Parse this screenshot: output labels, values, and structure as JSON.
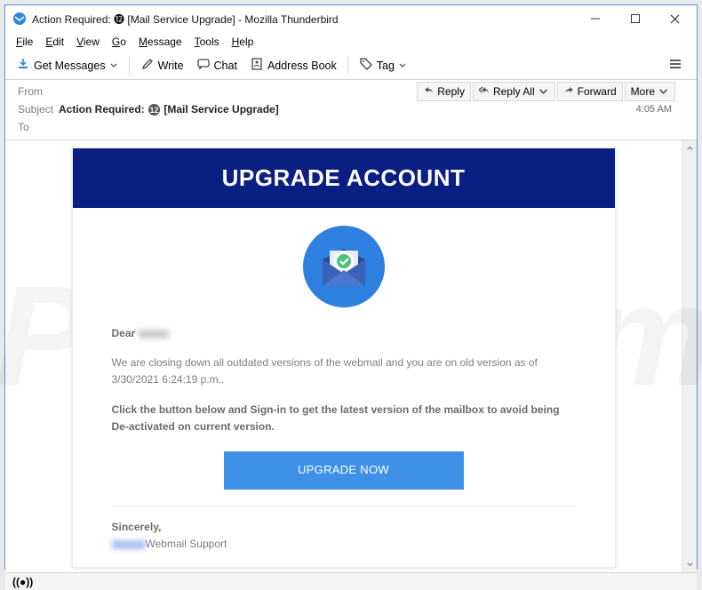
{
  "window": {
    "title": "Action Required: ⓬ [Mail Service Upgrade] - Mozilla Thunderbird"
  },
  "menubar": [
    "File",
    "Edit",
    "View",
    "Go",
    "Message",
    "Tools",
    "Help"
  ],
  "toolbar": {
    "get_messages": "Get Messages",
    "write": "Write",
    "chat": "Chat",
    "address_book": "Address Book",
    "tag": "Tag"
  },
  "actions": {
    "reply": "Reply",
    "reply_all": "Reply All",
    "forward": "Forward",
    "more": "More"
  },
  "headers": {
    "from_label": "From",
    "subject_label": "Subject",
    "to_label": "To",
    "subject_prefix": "Action Required: ",
    "subject_suffix": " [Mail Service Upgrade]",
    "time": "4:05 AM"
  },
  "email": {
    "banner": "UPGRADE ACCOUNT",
    "dear": "Dear",
    "para1": "We are closing down all outdated versions of the webmail and you are on old version as of 3/30/2021 6:24:19 p.m..",
    "para2": "Click the button below and Sign-in to get the latest version of the mailbox to avoid being De-activated on current version.",
    "button": "UPGRADE NOW",
    "sincerely": "Sincerely,",
    "support_suffix": "Webmail Support"
  },
  "status": {
    "signal": "((•))"
  }
}
